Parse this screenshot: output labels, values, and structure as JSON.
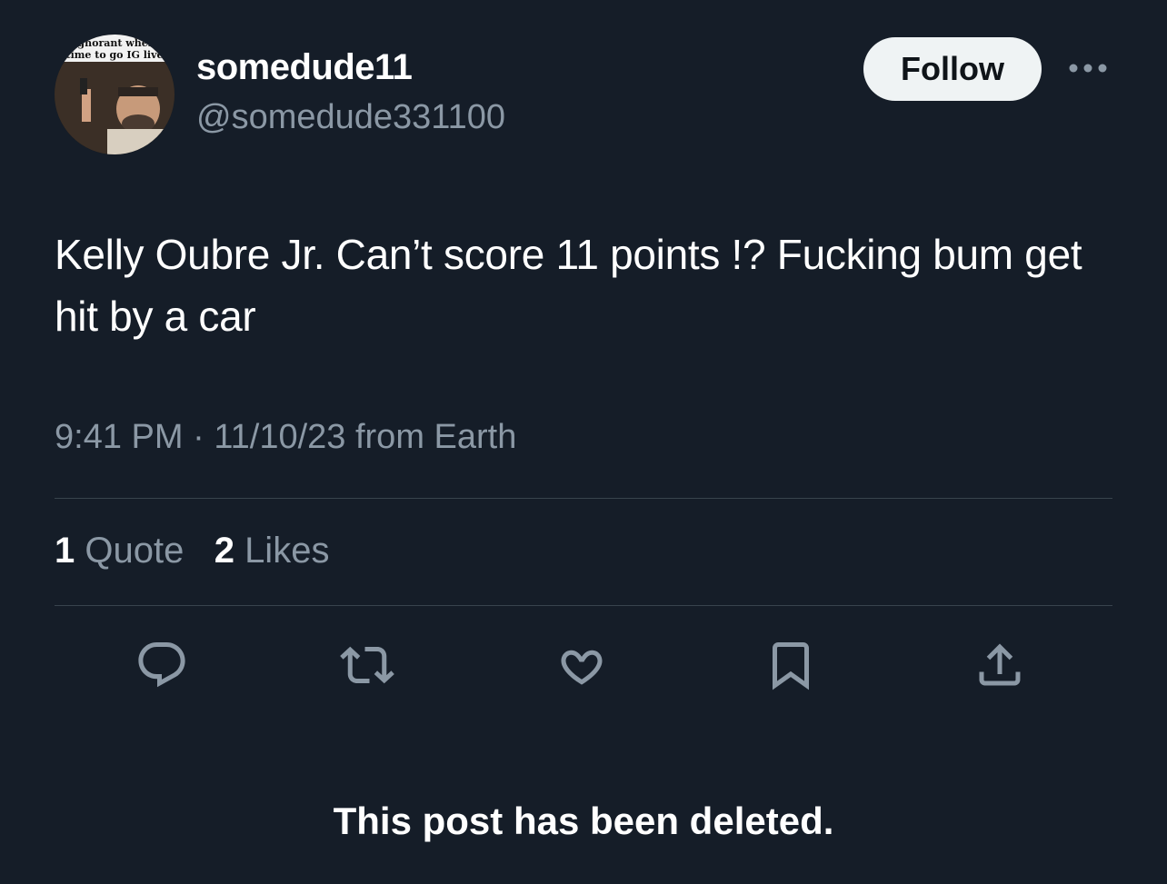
{
  "user": {
    "display_name": "somedude11",
    "handle": "@somedude331100",
    "avatar_caption": "ignorant when time to go IG live"
  },
  "header": {
    "follow_label": "Follow",
    "more_icon": "more-horizontal-icon"
  },
  "tweet": {
    "text": "Kelly Oubre Jr. Can’t score 11 points !? Fucking bum get hit by a car",
    "time": "9:41 PM",
    "separator": "·",
    "date": "11/10/23 from Earth"
  },
  "stats": {
    "quotes_count": "1",
    "quotes_label": "Quote",
    "likes_count": "2",
    "likes_label": "Likes"
  },
  "actions": [
    {
      "name": "reply",
      "icon": "reply-icon"
    },
    {
      "name": "repost",
      "icon": "repost-icon"
    },
    {
      "name": "like",
      "icon": "heart-icon"
    },
    {
      "name": "bookmark",
      "icon": "bookmark-icon"
    },
    {
      "name": "share",
      "icon": "share-icon"
    }
  ],
  "status": {
    "deleted_notice": "This post has been deleted."
  },
  "colors": {
    "background": "#151d28",
    "primary_text": "#ffffff",
    "secondary_text": "#8b98a5",
    "divider": "#38444d",
    "follow_bg": "#eff3f4"
  }
}
